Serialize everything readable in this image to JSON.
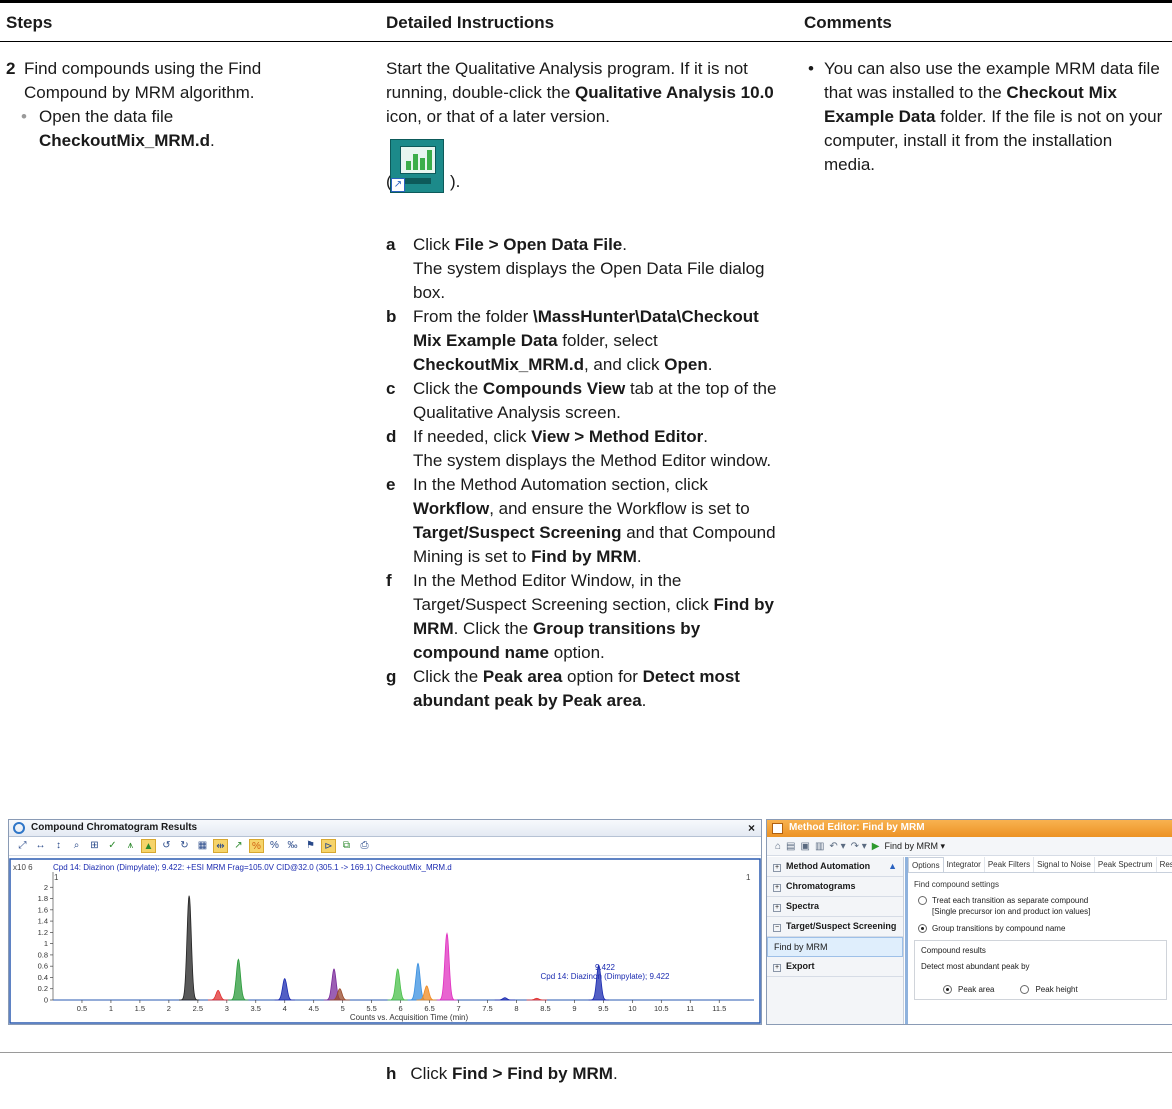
{
  "columns": {
    "steps": "Steps",
    "detailed": "Detailed Instructions",
    "comments": "Comments"
  },
  "step": {
    "number": "2",
    "text": "Find compounds using the Find Compound by MRM algorithm.",
    "sub_pre": "Open the data file",
    "sub_file": "CheckoutMix_MRM.d",
    "sub_post": "."
  },
  "detail": {
    "intro_pre": "Start the Qualitative Analysis program. If it is not running, double-click the ",
    "intro_bold": "Qualitative Analysis 10.0",
    "intro_post": " icon, or that of a later version.",
    "icon_open": "(",
    "icon_close": ").",
    "icon_name": "qualitative-analysis-app-icon"
  },
  "items": {
    "a": {
      "letter": "a",
      "t1": "Click ",
      "b1": "File > Open Data File",
      "t2": ".",
      "t3": "The system displays the Open Data File dialog box."
    },
    "b": {
      "letter": "b",
      "t1": "From the folder ",
      "b1": "\\MassHunter\\Data\\Checkout Mix Example Data",
      "t2": " folder, select ",
      "b2": "CheckoutMix_MRM.d",
      "t3": ", and click ",
      "b3": "Open",
      "t4": "."
    },
    "c": {
      "letter": "c",
      "t1": "Click the ",
      "b1": "Compounds View",
      "t2": " tab at the top of the Qualitative Analysis screen."
    },
    "d": {
      "letter": "d",
      "t1": "If needed, click ",
      "b1": "View > Method Editor",
      "t2": ".",
      "t3": "The system displays the Method Editor window."
    },
    "e": {
      "letter": "e",
      "t1": "In the Method Automation section, click ",
      "b1": "Workflow",
      "t2": ", and ensure the Workflow is set to ",
      "b2": "Target/Suspect Screening",
      "t3": " and that Compound Mining is set to ",
      "b3": "Find by MRM",
      "t4": "."
    },
    "f": {
      "letter": "f",
      "t1": "In the Method Editor Window, in the Target/Suspect Screening section, click ",
      "b1": "Find by MRM",
      "t2": ". Click the ",
      "b2": "Group transitions by compound name",
      "t3": " option."
    },
    "g": {
      "letter": "g",
      "t1": "Click the ",
      "b1": "Peak area",
      "t2": " option for ",
      "b2": "Detect most abundant peak by Peak area",
      "t3": "."
    },
    "h": {
      "letter": "h",
      "t1": "Click ",
      "b1": "Find > Find by MRM",
      "t2": "."
    }
  },
  "comment": {
    "t1": "You can also use the example MRM data file that was installed to the ",
    "b1": "Checkout Mix Example Data",
    "t2": " folder. If the file is not on your computer, install it from the installation media."
  },
  "ccr": {
    "title": "Compound Chromatogram Results",
    "close": "×",
    "toolbar_icons": [
      "zoom-out-icon",
      "pan-horizontal-icon",
      "pan-vertical-icon",
      "zoom-icon",
      "autoscale-icon",
      "integrate-icon",
      "peak-icon",
      "peak-fill-icon",
      "undo-icon",
      "redo-icon",
      "table-icon",
      "overlay-icon",
      "anchor-icon",
      "percent-icon",
      "percent-alt-icon",
      "percent-scale-icon",
      "peak-label-icon",
      "spectrum-icon",
      "copy-icon",
      "print-icon"
    ],
    "y_exp": "x10 6",
    "header_label": "Cpd 14: Diazinon (Dimpylate); 9.422: +ESI MRM Frag=105.0V CID@32.0 (305.1 -> 169.1) CheckoutMix_MRM.d",
    "marker_left": "1",
    "marker_right": "1",
    "peak_label_rt": "9.422",
    "peak_label_name": "Cpd 14: Diazinon (Dimpylate); 9.422",
    "x_label": "Counts vs. Acquisition Time (min)"
  },
  "chart_data": {
    "type": "line",
    "xlabel": "Counts vs. Acquisition Time (min)",
    "ylabel": "x10 6",
    "xlim": [
      0,
      12.1
    ],
    "ylim": [
      0,
      2.2
    ],
    "x_ticks": [
      0.5,
      1,
      1.5,
      2,
      2.5,
      3,
      3.5,
      4,
      4.5,
      5,
      5.5,
      6,
      6.5,
      7,
      7.5,
      8,
      8.5,
      9,
      9.5,
      10,
      10.5,
      11,
      11.5
    ],
    "y_ticks": [
      0,
      0.2,
      0.4,
      0.6,
      0.8,
      1,
      1.2,
      1.4,
      1.6,
      1.8,
      2
    ],
    "peaks": [
      {
        "rt": 2.35,
        "height": 1.85,
        "color": "#222222"
      },
      {
        "rt": 2.85,
        "height": 0.17,
        "color": "#e03030"
      },
      {
        "rt": 3.2,
        "height": 0.72,
        "color": "#2a9a3a"
      },
      {
        "rt": 4.0,
        "height": 0.38,
        "color": "#1a2ab0"
      },
      {
        "rt": 4.85,
        "height": 0.55,
        "color": "#7a2a9a"
      },
      {
        "rt": 4.95,
        "height": 0.2,
        "color": "#9a4a2a"
      },
      {
        "rt": 5.95,
        "height": 0.55,
        "color": "#4ac04a"
      },
      {
        "rt": 6.3,
        "height": 0.65,
        "color": "#3a90e0"
      },
      {
        "rt": 6.45,
        "height": 0.25,
        "color": "#f08a20"
      },
      {
        "rt": 6.8,
        "height": 1.18,
        "color": "#e030c0"
      },
      {
        "rt": 7.8,
        "height": 0.04,
        "color": "#1a2ab0"
      },
      {
        "rt": 8.35,
        "height": 0.03,
        "color": "#e03030"
      },
      {
        "rt": 9.42,
        "height": 0.62,
        "color": "#1a2ab0"
      }
    ]
  },
  "me": {
    "title": "Method Editor: Find by MRM",
    "find_by": "Find by MRM",
    "sections": [
      "Method Automation",
      "Chromatograms",
      "Spectra",
      "Target/Suspect Screening",
      "Find by MRM",
      "Export"
    ],
    "tabs": [
      "Options",
      "Integrator",
      "Peak Filters",
      "Signal to Noise",
      "Peak Spectrum",
      "Results"
    ],
    "group1_label": "Find compound settings",
    "opt1": "Treat each transition as separate compound",
    "opt1_sub": "[Single precursor ion and product ion values]",
    "opt2": "Group transitions by compound name",
    "group2_label": "Compound results",
    "detect_label": "Detect most abundant peak by",
    "pk_area": "Peak area",
    "pk_height": "Peak height"
  }
}
